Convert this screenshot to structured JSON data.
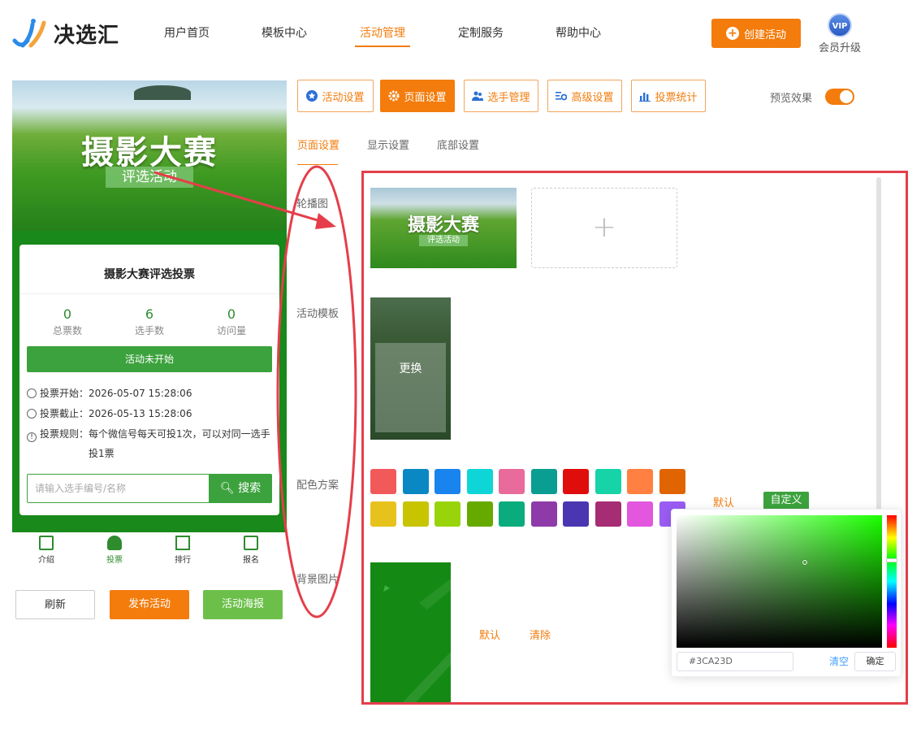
{
  "brand": {
    "name": "决选汇"
  },
  "nav": {
    "items": [
      {
        "label": "用户首页",
        "active": false
      },
      {
        "label": "模板中心",
        "active": false
      },
      {
        "label": "活动管理",
        "active": true
      },
      {
        "label": "定制服务",
        "active": false
      },
      {
        "label": "帮助中心",
        "active": false
      }
    ],
    "create_label": "创建活动",
    "vip_badge": "VIP",
    "vip_label": "会员升级"
  },
  "preview": {
    "banner_title": "摄影大赛",
    "banner_subtitle": "评选活动",
    "card_title": "摄影大赛评选投票",
    "stats": [
      {
        "value": "0",
        "label": "总票数"
      },
      {
        "value": "6",
        "label": "选手数"
      },
      {
        "value": "0",
        "label": "访问量"
      }
    ],
    "status": "活动未开始",
    "info": [
      {
        "text": "投票开始：2026-05-07 15:28:06"
      },
      {
        "text": "投票截止：2026-05-13 15:28:06"
      },
      {
        "text": "投票规则：每个微信号每天可投1次，可以对同一选手"
      },
      {
        "text": "投1票"
      }
    ],
    "search_placeholder": "请输入选手编号/名称",
    "search_label": "搜索",
    "tabs": [
      "介绍",
      "投票",
      "排行",
      "报名"
    ]
  },
  "preview_actions": {
    "refresh": "刷新",
    "publish": "发布活动",
    "poster": "活动海报"
  },
  "toolbar": {
    "items": [
      {
        "label": "活动设置",
        "icon": "star-icon",
        "active": false
      },
      {
        "label": "页面设置",
        "icon": "gear-icon",
        "active": true
      },
      {
        "label": "选手管理",
        "icon": "users-icon",
        "active": false
      },
      {
        "label": "高级设置",
        "icon": "sliders-icon",
        "active": false
      },
      {
        "label": "投票统计",
        "icon": "bar-chart-icon",
        "active": false
      }
    ],
    "preview_label": "预览效果",
    "preview_enabled": true
  },
  "subtabs": [
    {
      "label": "页面设置",
      "active": true
    },
    {
      "label": "显示设置",
      "active": false
    },
    {
      "label": "底部设置",
      "active": false
    }
  ],
  "sections": {
    "carousel": "轮播图",
    "template": "活动模板",
    "template_action": "更换",
    "carousel_title": "摄影大赛",
    "carousel_subtitle": "评选活动",
    "color": "配色方案",
    "color_default": "默认",
    "color_custom": "自定义",
    "background": "背景图片",
    "bg_default": "默认",
    "bg_clear": "清除"
  },
  "swatches": [
    "#f25a5a",
    "#0a88c4",
    "#1a84ee",
    "#0ed6d6",
    "#e86b9c",
    "#0a9d92",
    "#e00d0d",
    "#17d3a8",
    "#ff8040",
    "#e06400",
    "#e8c21c",
    "#c8c400",
    "#99d40b",
    "#66aa00",
    "#0aac7e",
    "#8e3aa8",
    "#4a36b0",
    "#a62c74",
    "#e257de",
    "#9a5cf2"
  ],
  "picker": {
    "hex": "#3CA23D",
    "clear": "清空",
    "confirm": "确定"
  },
  "colors": {
    "accent": "#f37c0c",
    "green": "#3ca23d",
    "annotation": "#e53e4a"
  }
}
